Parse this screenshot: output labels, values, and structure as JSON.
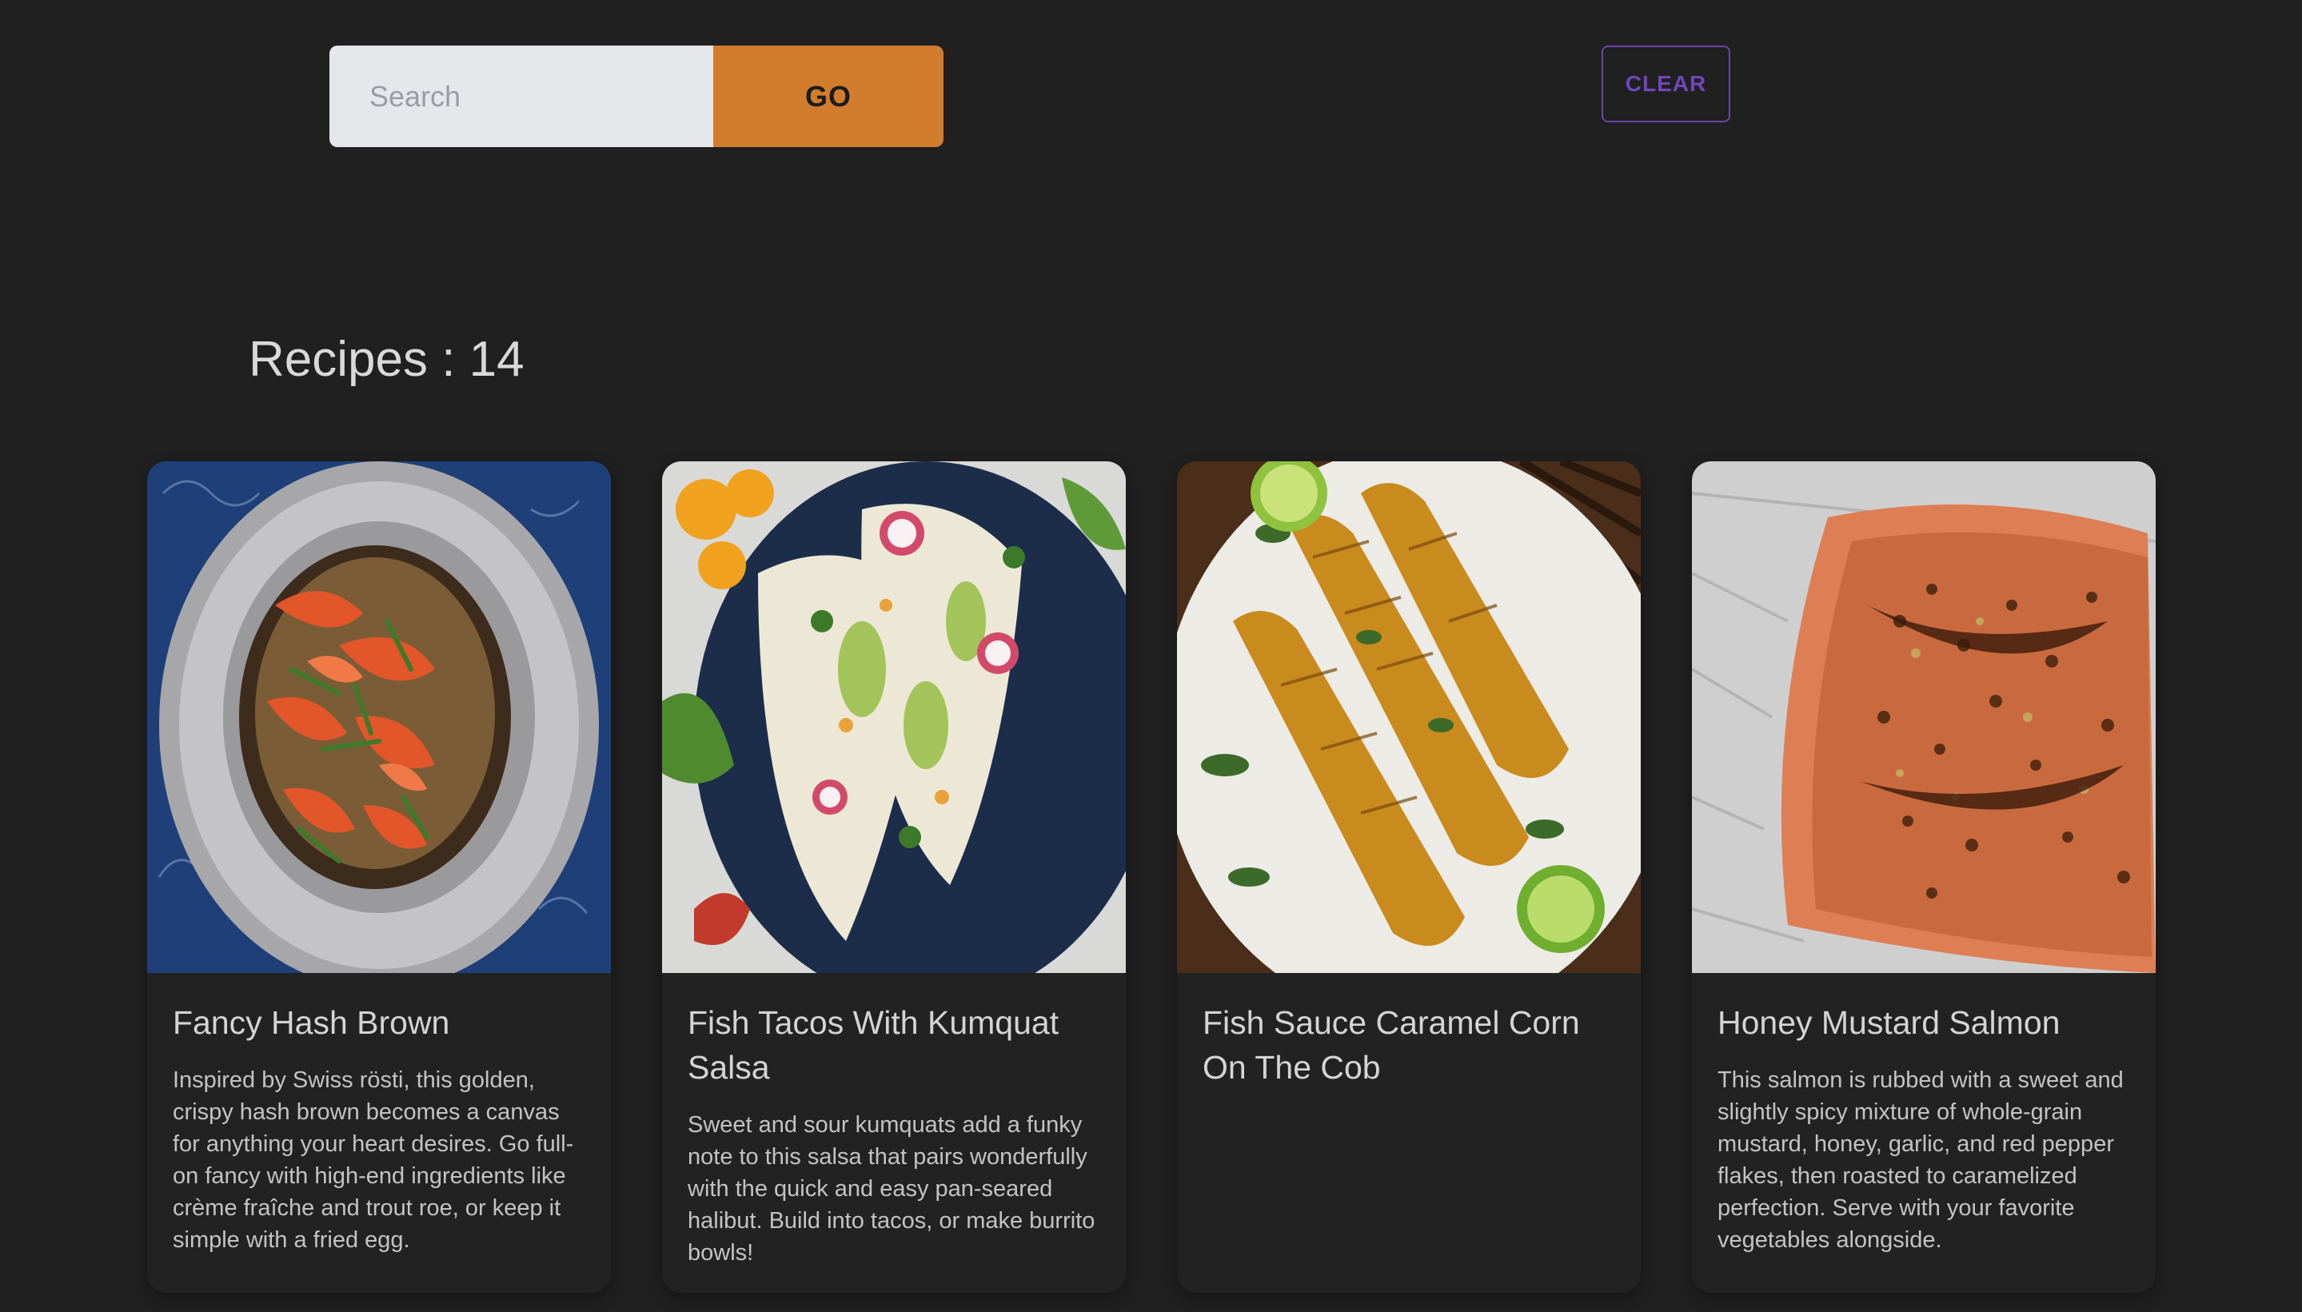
{
  "search": {
    "placeholder": "Search",
    "value": "",
    "go_label": "GO"
  },
  "toolbar": {
    "clear_label": "CLEAR"
  },
  "results": {
    "count_text": "Recipes : 14"
  },
  "colors": {
    "background": "#202020",
    "accent": "#d27d2d",
    "clear_outline": "#6a45a8",
    "search_field": "#e6e7ea"
  },
  "recipes": [
    {
      "title": "Fancy Hash Brown",
      "description": "Inspired by Swiss rösti, this golden, crispy hash brown becomes a canvas for anything your heart desires. Go full-on fancy with high-end ingredients like crème fraîche and trout roe, or keep it simple with a fried egg.",
      "image": "smoked-salmon-hash-brown-photo"
    },
    {
      "title": "Fish Tacos With Kumquat Salsa",
      "description": "Sweet and sour kumquats add a funky note to this salsa that pairs wonderfully with the quick and easy pan-seared halibut. Build into tacos, or make burrito bowls!",
      "image": "fish-tacos-photo"
    },
    {
      "title": "Fish Sauce Caramel Corn On The Cob",
      "description": "",
      "image": "grilled-corn-photo"
    },
    {
      "title": "Honey Mustard Salmon",
      "description": "This salmon is rubbed with a sweet and slightly spicy mixture of whole-grain mustard, honey, garlic, and red pepper flakes, then roasted to caramelized perfection. Serve with your favorite vegetables alongside.",
      "image": "glazed-salmon-photo"
    }
  ]
}
